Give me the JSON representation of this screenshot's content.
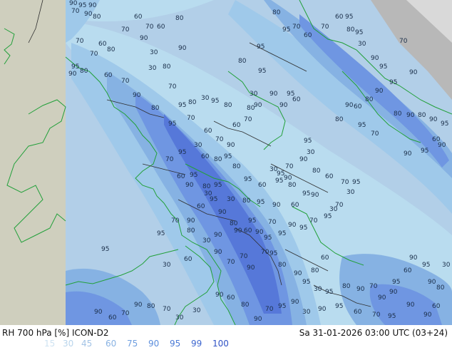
{
  "colors": {
    "background": "#9a9a9a",
    "land": "#cfcfbe",
    "coast": "#22a03a",
    "border": "#2e2e2e",
    "bands": [
      "#b9dcef",
      "#9fc9ea",
      "#86b2e3",
      "#6f96e2",
      "#5678d9"
    ]
  },
  "contour_labels": [
    "90",
    "95",
    "90",
    "70",
    "90",
    "80",
    "60",
    "70",
    "60",
    "80",
    "70",
    "90",
    "60",
    "70",
    "80",
    "30",
    "70",
    "95",
    "80",
    "90",
    "60",
    "70",
    "80",
    "90",
    "30",
    "70",
    "90",
    "80",
    "95",
    "80",
    "30",
    "70",
    "95",
    "95",
    "80",
    "60",
    "70",
    "90",
    "60",
    "70",
    "80",
    "90",
    "30",
    "95",
    "90",
    "95",
    "60",
    "90",
    "80",
    "95",
    "80",
    "95",
    "70",
    "60",
    "70",
    "60",
    "95",
    "80",
    "95",
    "30",
    "90",
    "95",
    "70",
    "90",
    "95",
    "90",
    "80",
    "60",
    "80",
    "90",
    "80",
    "90",
    "95",
    "60",
    "90",
    "95",
    "90",
    "70",
    "95",
    "90",
    "80",
    "95",
    "30",
    "90",
    "80",
    "60",
    "70",
    "95",
    "30",
    "70",
    "95",
    "30",
    "90",
    "95",
    "70",
    "30",
    "95",
    "90",
    "80",
    "95",
    "60",
    "95",
    "80",
    "95",
    "80",
    "60",
    "30",
    "95",
    "70",
    "60",
    "90",
    "95",
    "80",
    "30",
    "95",
    "90",
    "80",
    "90",
    "60",
    "95",
    "90",
    "95",
    "70",
    "95",
    "90",
    "95",
    "70",
    "60",
    "90",
    "95",
    "80",
    "30",
    "95",
    "60",
    "90",
    "70",
    "95",
    "80",
    "30",
    "90",
    "95",
    "30",
    "60",
    "90",
    "70",
    "70",
    "90",
    "70",
    "95",
    "80",
    "90",
    "80",
    "60",
    "95",
    "30",
    "95",
    "80",
    "90",
    "70",
    "90",
    "90",
    "95",
    "60",
    "90",
    "95",
    "90",
    "80",
    "30",
    "60",
    "90",
    "90",
    "95",
    "70",
    "60",
    "95",
    "90",
    "30",
    "90",
    "95",
    "70",
    "90",
    "80",
    "60",
    "90",
    "30",
    "30",
    "70",
    "80",
    "90",
    "70",
    "60",
    "90"
  ],
  "footer": {
    "title": "RH 700 hPa [%] ICON-D2",
    "time": "Sa 31-01-2026 03:00 UTC (03+24)",
    "scale": [
      {
        "label": "15",
        "color": "#cfe3f2"
      },
      {
        "label": "30",
        "color": "#b9d5ec"
      },
      {
        "label": "45",
        "color": "#a3c3e6"
      },
      {
        "label": "60",
        "color": "#89b3e3"
      },
      {
        "label": "75",
        "color": "#6f9fe0"
      },
      {
        "label": "90",
        "color": "#5b8ddc"
      },
      {
        "label": "95",
        "color": "#4a7ad6"
      },
      {
        "label": "99",
        "color": "#3d66cf"
      },
      {
        "label": "100",
        "color": "#2f52c5"
      }
    ]
  }
}
